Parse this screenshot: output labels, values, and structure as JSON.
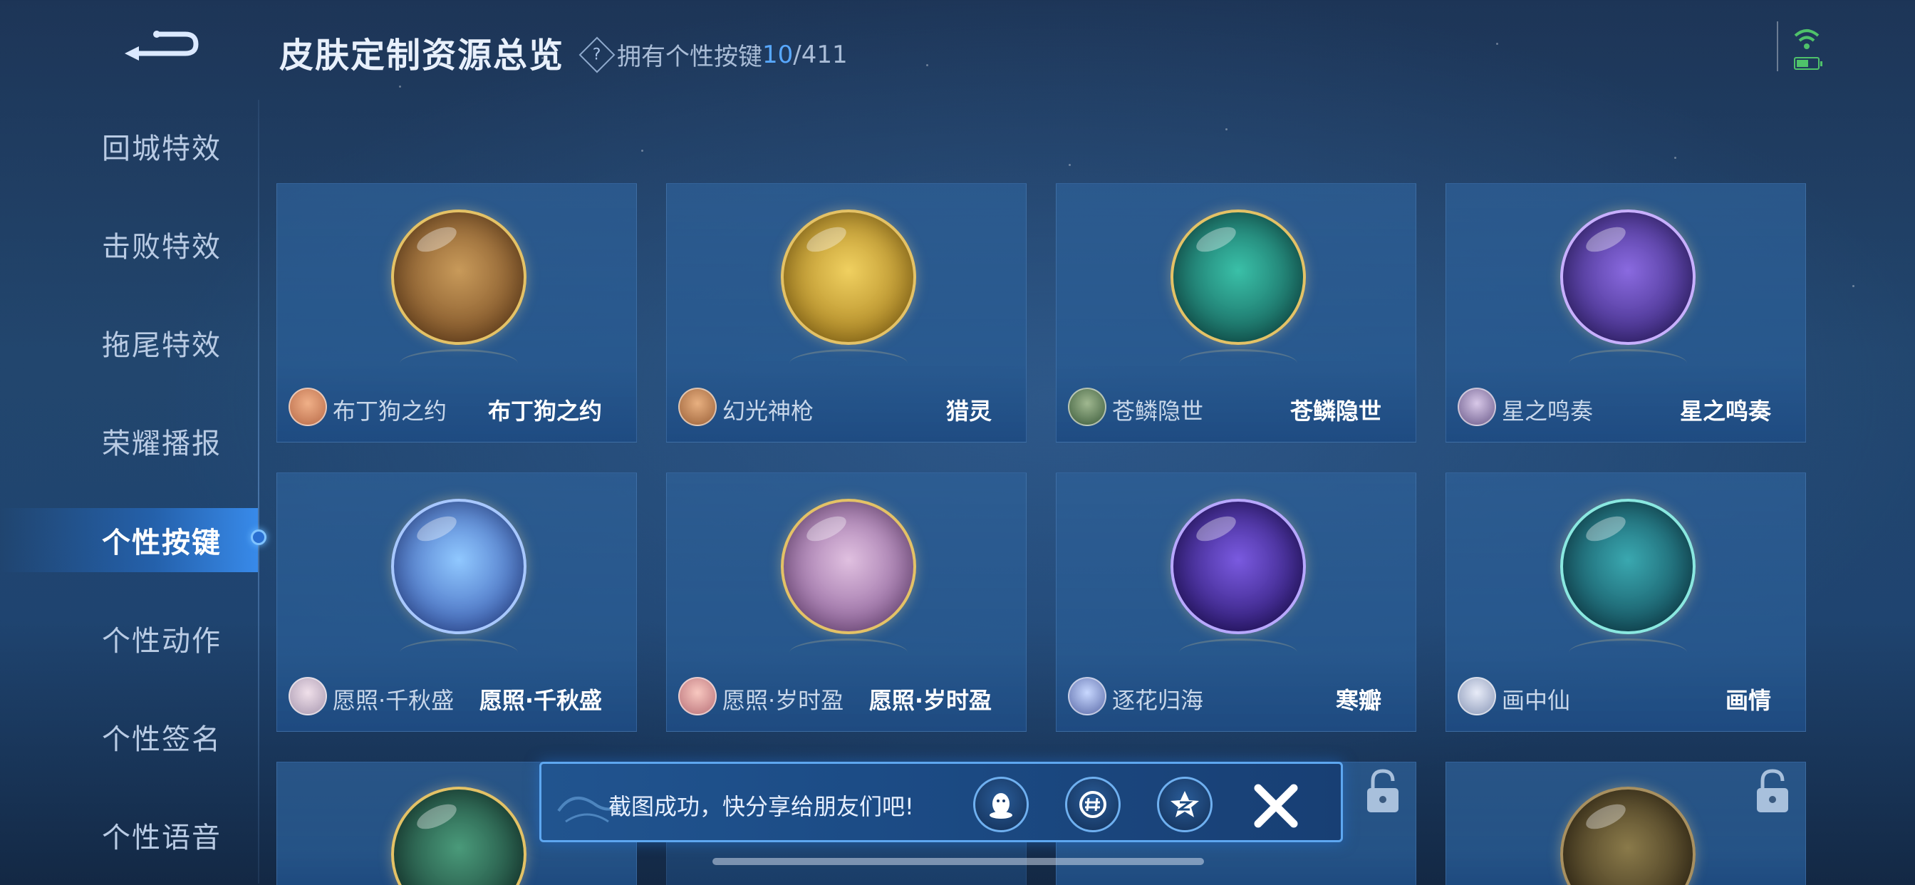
{
  "header": {
    "title": "皮肤定制资源总览",
    "owned_label": "拥有个性按键",
    "owned_count": "10",
    "owned_total": "/411",
    "help_symbol": "?"
  },
  "sidebar": {
    "items": [
      {
        "label": "回城特效",
        "active": false
      },
      {
        "label": "击败特效",
        "active": false
      },
      {
        "label": "拖尾特效",
        "active": false
      },
      {
        "label": "荣耀播报",
        "active": false
      },
      {
        "label": "个性按键",
        "active": true
      },
      {
        "label": "个性动作",
        "active": false
      },
      {
        "label": "个性签名",
        "active": false
      },
      {
        "label": "个性语音",
        "active": false
      }
    ]
  },
  "cards": [
    {
      "hero": "布丁狗之约",
      "skin": "布丁狗之约",
      "orb_color": "#8a5a2a",
      "avatar_color": "#d98a6a",
      "icon": "bow-icon"
    },
    {
      "hero": "幻光神枪",
      "skin": "猎灵",
      "orb_color": "#b8901e",
      "avatar_color": "#c68a5a",
      "icon": "spear-icon"
    },
    {
      "hero": "苍鳞隐世",
      "skin": "苍鳞隐世",
      "orb_color": "#1f7f7a",
      "avatar_color": "#6a8a6a",
      "icon": "wing-icon"
    },
    {
      "hero": "星之鸣奏",
      "skin": "星之鸣奏",
      "orb_color": "#5a3aa8",
      "avatar_color": "#a89ac8",
      "icon": "music-icon"
    },
    {
      "hero": "愿照·千秋盛",
      "skin": "愿照·千秋盛",
      "orb_color": "#3a6ac8",
      "avatar_color": "#d8c8d8",
      "icon": "flower-icon"
    },
    {
      "hero": "愿照·岁时盈",
      "skin": "愿照·岁时盈",
      "orb_color": "#a07ab8",
      "avatar_color": "#e8a8a8",
      "icon": "bow-icon"
    },
    {
      "hero": "逐花归海",
      "skin": "寒瓣",
      "orb_color": "#4a2a9a",
      "avatar_color": "#a8b8e8",
      "icon": "blade-icon"
    },
    {
      "hero": "画中仙",
      "skin": "画情",
      "orb_color": "#1a6a7a",
      "avatar_color": "#c8d0e8",
      "icon": "fan-icon"
    },
    {
      "hero": "",
      "skin": "",
      "orb_color": "#2a6a5a",
      "avatar_color": "",
      "icon": "dragon-icon"
    },
    {
      "hero": "",
      "skin": "",
      "orb_color": "#5a4a2a",
      "avatar_color": "",
      "icon": "lock-icon"
    }
  ],
  "toast": {
    "message": "截图成功，快分享给朋友们吧!",
    "share_targets": [
      "qq-icon",
      "wechat-moments-icon",
      "qzone-icon"
    ],
    "close_icon": "close-icon"
  },
  "colors": {
    "accent": "#58a8ff",
    "gold": "#e4c266",
    "active_tab": "#3a8cf0"
  }
}
